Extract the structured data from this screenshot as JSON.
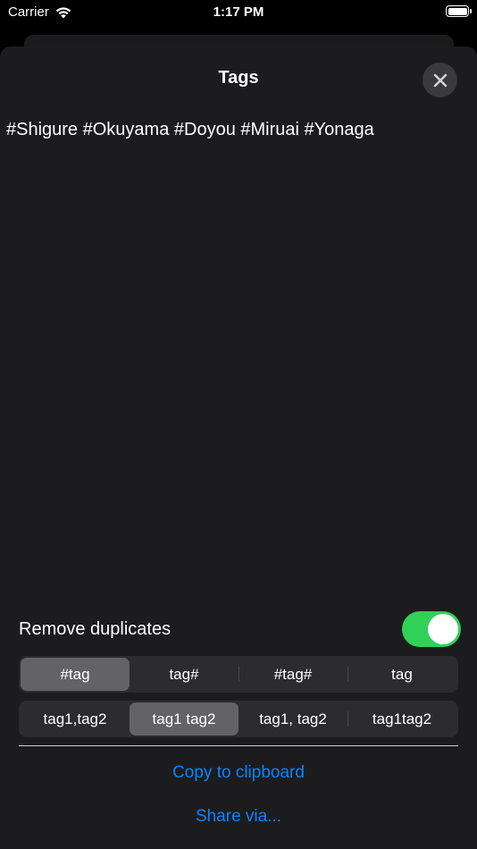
{
  "status_bar": {
    "carrier": "Carrier",
    "time": "1:17 PM"
  },
  "sheet": {
    "title": "Tags",
    "tags_text": "#Shigure #Okuyama #Doyou #Miruai #Yonaga"
  },
  "options": {
    "remove_duplicates_label": "Remove duplicates",
    "remove_duplicates_on": true,
    "format_segments": [
      {
        "label": "#tag",
        "selected": true
      },
      {
        "label": "tag#",
        "selected": false
      },
      {
        "label": "#tag#",
        "selected": false
      },
      {
        "label": "tag",
        "selected": false
      }
    ],
    "separator_segments": [
      {
        "label": "tag1,tag2",
        "selected": false
      },
      {
        "label": "tag1 tag2",
        "selected": true
      },
      {
        "label": "tag1, tag2",
        "selected": false
      },
      {
        "label": "tag1tag2",
        "selected": false
      }
    ]
  },
  "actions": {
    "copy_label": "Copy to clipboard",
    "share_label": "Share via..."
  },
  "colors": {
    "accent": "#0a84ff",
    "toggle_on": "#30d158",
    "sheet_background": "#1c1c1e"
  },
  "icons": {
    "close": "close-icon",
    "wifi": "wifi-icon",
    "battery": "battery-icon"
  }
}
